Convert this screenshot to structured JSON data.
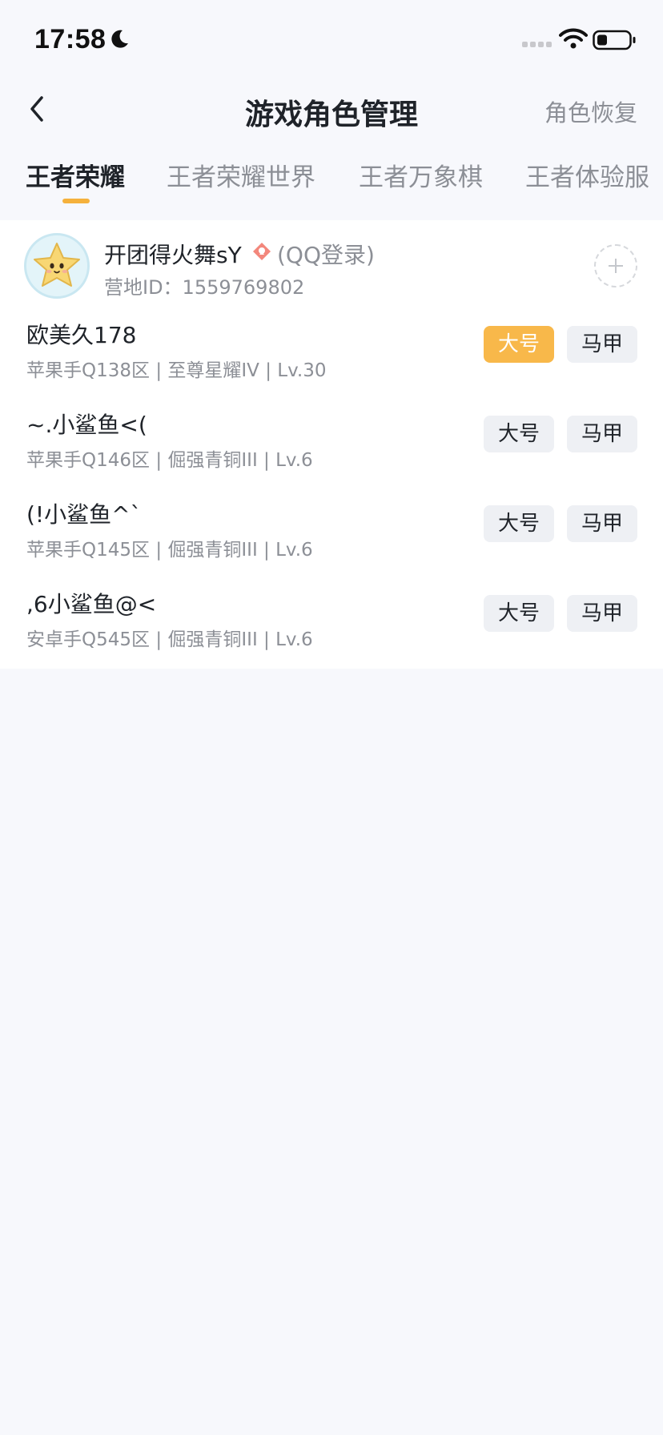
{
  "status_bar": {
    "time": "17:58"
  },
  "nav": {
    "title": "游戏角色管理",
    "action": "角色恢复"
  },
  "tabs": [
    {
      "label": "王者荣耀",
      "active": true
    },
    {
      "label": "王者荣耀世界",
      "active": false
    },
    {
      "label": "王者万象棋",
      "active": false
    },
    {
      "label": "王者体验服",
      "active": false
    }
  ],
  "account": {
    "name": "开团得火舞sY",
    "login": "(QQ登录)",
    "camp_id": "营地ID：1559769802"
  },
  "roles": [
    {
      "name": "欧美久178",
      "meta": "苹果手Q138区 | 至尊星耀IV | Lv.30",
      "main_label": "大号",
      "alt_label": "马甲",
      "main_selected": true
    },
    {
      "name": "~.小鲨鱼<(",
      "meta": "苹果手Q146区 | 倔强青铜III | Lv.6",
      "main_label": "大号",
      "alt_label": "马甲",
      "main_selected": false
    },
    {
      "name": "(!小鲨鱼^`",
      "meta": "苹果手Q145区 | 倔强青铜III | Lv.6",
      "main_label": "大号",
      "alt_label": "马甲",
      "main_selected": false
    },
    {
      "name": ",6小鲨鱼@<",
      "meta": "安卓手Q545区 | 倔强青铜III | Lv.6",
      "main_label": "大号",
      "alt_label": "马甲",
      "main_selected": false
    }
  ],
  "colors": {
    "accent": "#f8b84a",
    "background": "#f7f8fc",
    "card": "#ffffff",
    "secondary_text": "#8c8f96"
  }
}
